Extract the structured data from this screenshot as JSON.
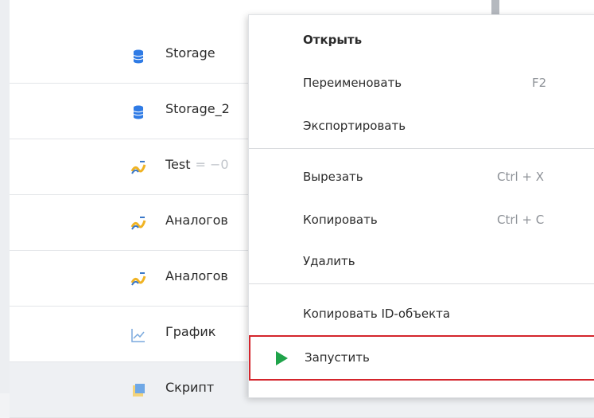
{
  "list": {
    "items": [
      {
        "icon": "database-icon",
        "label": "Storage",
        "value": ""
      },
      {
        "icon": "database-icon",
        "label": "Storage_2",
        "value": ""
      },
      {
        "icon": "analog-signal-icon",
        "label": "Test",
        "value": "= −0"
      },
      {
        "icon": "analog-signal-icon",
        "label": "Аналогов",
        "value": ""
      },
      {
        "icon": "analog-signal-icon",
        "label": "Аналогов",
        "value": ""
      },
      {
        "icon": "chart-icon",
        "label": "График",
        "value": ""
      },
      {
        "icon": "script-icon",
        "label": "Скрипт",
        "value": ""
      }
    ]
  },
  "context_menu": {
    "open": "Открыть",
    "rename": "Переименовать",
    "rename_shortcut": "F2",
    "export": "Экспортировать",
    "cut": "Вырезать",
    "cut_shortcut": "Ctrl + X",
    "copy": "Копировать",
    "copy_shortcut": "Ctrl + C",
    "delete": "Удалить",
    "copy_id": "Копировать ID-объекта",
    "run": "Запустить"
  },
  "colors": {
    "run_icon": "#1fa34a",
    "highlight_border": "#d4252c",
    "database_icon": "#2f7be5"
  }
}
